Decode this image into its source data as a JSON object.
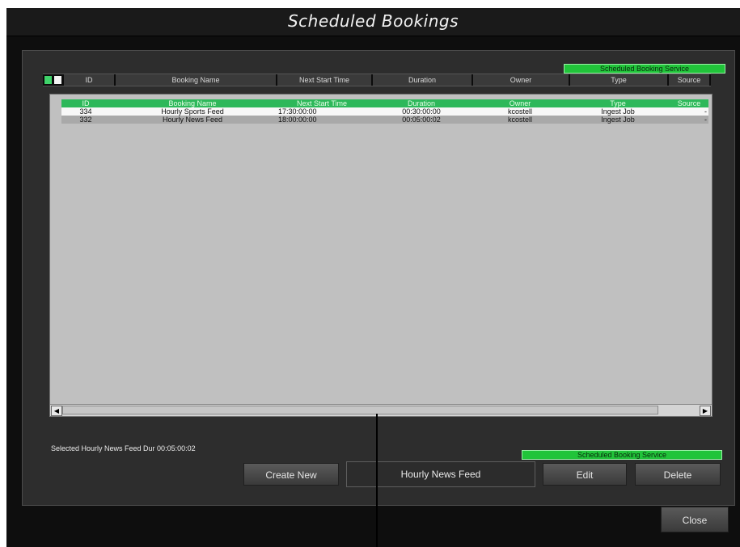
{
  "window": {
    "title": "Scheduled Bookings"
  },
  "service_badge_top": "Scheduled Booking Service",
  "service_badge_bottom": "Scheduled Booking Service",
  "columns": [
    "ID",
    "Booking Name",
    "Next Start Time",
    "Duration",
    "Owner",
    "Type",
    "Source"
  ],
  "grid_columns": [
    "ID",
    "Booking Name",
    "Next Start Time",
    "Duration",
    "Owner",
    "Type",
    "Source"
  ],
  "rows": [
    {
      "id": "334",
      "name": "Hourly Sports Feed",
      "start": "17:30:00:00",
      "duration": "00:30:00:00",
      "owner": "kcostell",
      "type": "Ingest Job",
      "source": "-"
    },
    {
      "id": "332",
      "name": "Hourly News Feed",
      "start": "18:00:00:00",
      "duration": "00:05:00:02",
      "owner": "kcostell",
      "type": "Ingest Job",
      "source": "-"
    }
  ],
  "selected_label": "Selected Hourly News Feed Dur 00:05:00:02",
  "actions": {
    "create": "Create New",
    "selected_name": "Hourly News Feed",
    "edit": "Edit",
    "delete": "Delete",
    "close": "Close"
  },
  "scrollbar": {
    "left_arrow": "◀",
    "right_arrow": "▶"
  },
  "colors": {
    "accent": "#21c43a",
    "grid_header": "#2db85a",
    "background": "#0e0e0e"
  }
}
